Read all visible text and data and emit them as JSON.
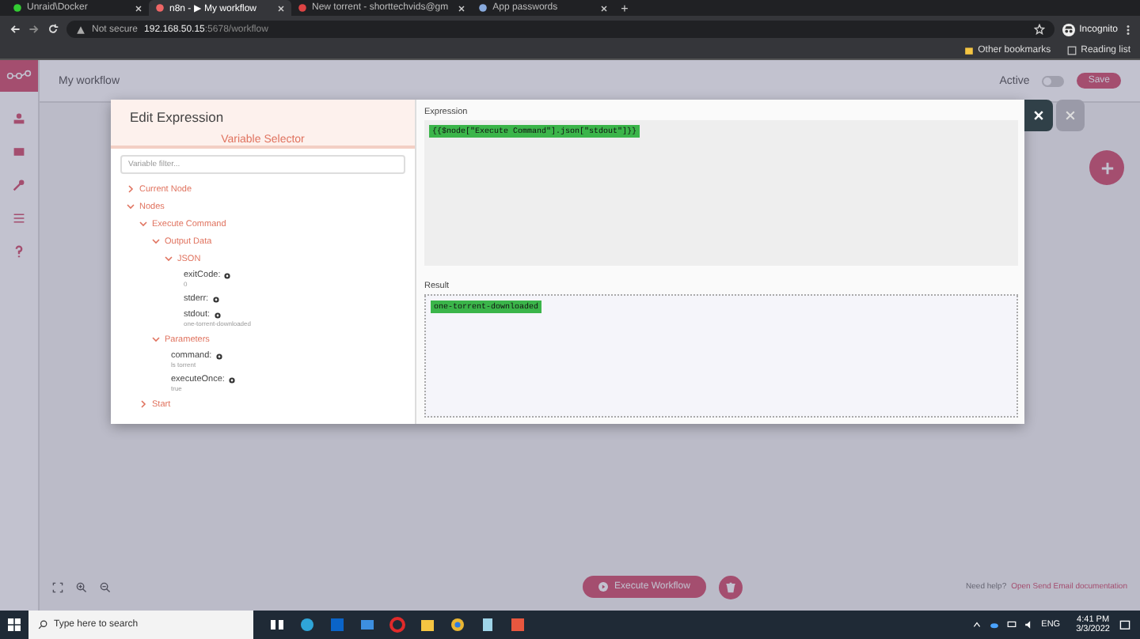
{
  "browser": {
    "tabs": [
      {
        "title": "Unraid\\Docker",
        "selected": false
      },
      {
        "title": "n8n - ▶ My workflow",
        "selected": true
      },
      {
        "title": "New torrent - shorttechvids@gm",
        "selected": false
      },
      {
        "title": "App passwords",
        "selected": false
      }
    ],
    "new_tab": "+",
    "security": "Not secure",
    "host": "192.168.50.15",
    "path": ":5678/workflow",
    "profile": "Incognito",
    "bookmarks": [
      "Other bookmarks",
      "Reading list"
    ]
  },
  "app": {
    "workflow_name": "My workflow",
    "active_label": "Active",
    "active": false,
    "save": "Save",
    "execute": "Execute Workflow",
    "help": "Need help?",
    "help_link": "Open Send Email documentation"
  },
  "modal": {
    "title": "Edit Expression",
    "selector_title": "Variable Selector",
    "filter_placeholder": "Variable filter...",
    "tree": [
      {
        "kind": "group",
        "label": "Current Node",
        "expanded": false
      },
      {
        "kind": "group",
        "label": "Nodes",
        "expanded": true,
        "children": [
          {
            "kind": "group",
            "label": "Execute Command",
            "expanded": true,
            "children": [
              {
                "kind": "group",
                "label": "Output Data",
                "expanded": true,
                "children": [
                  {
                    "kind": "group",
                    "label": "JSON",
                    "expanded": true,
                    "children": [
                      {
                        "kind": "variable",
                        "label": "exitCode:",
                        "value": "0"
                      },
                      {
                        "kind": "variable",
                        "label": "stderr:"
                      },
                      {
                        "kind": "variable",
                        "label": "stdout:",
                        "value": "one-torrent-downloaded"
                      }
                    ]
                  }
                ]
              },
              {
                "kind": "group",
                "label": "Parameters",
                "expanded": true,
                "children": [
                  {
                    "kind": "variable",
                    "label": "command:",
                    "value": "ls torrent"
                  },
                  {
                    "kind": "variable",
                    "label": "executeOnce:",
                    "value": "true"
                  }
                ]
              }
            ]
          },
          {
            "kind": "group",
            "label": "Start",
            "expanded": false
          }
        ]
      }
    ],
    "expression_label": "Expression",
    "expression": "{{$node[\"Execute Command\"].json[\"stdout\"]}}",
    "result_label": "Result",
    "result": "one-torrent-downloaded"
  },
  "taskbar": {
    "search_placeholder": "Type here to search",
    "lang": "ENG",
    "time": "4:41 PM",
    "date": "3/3/2022"
  }
}
